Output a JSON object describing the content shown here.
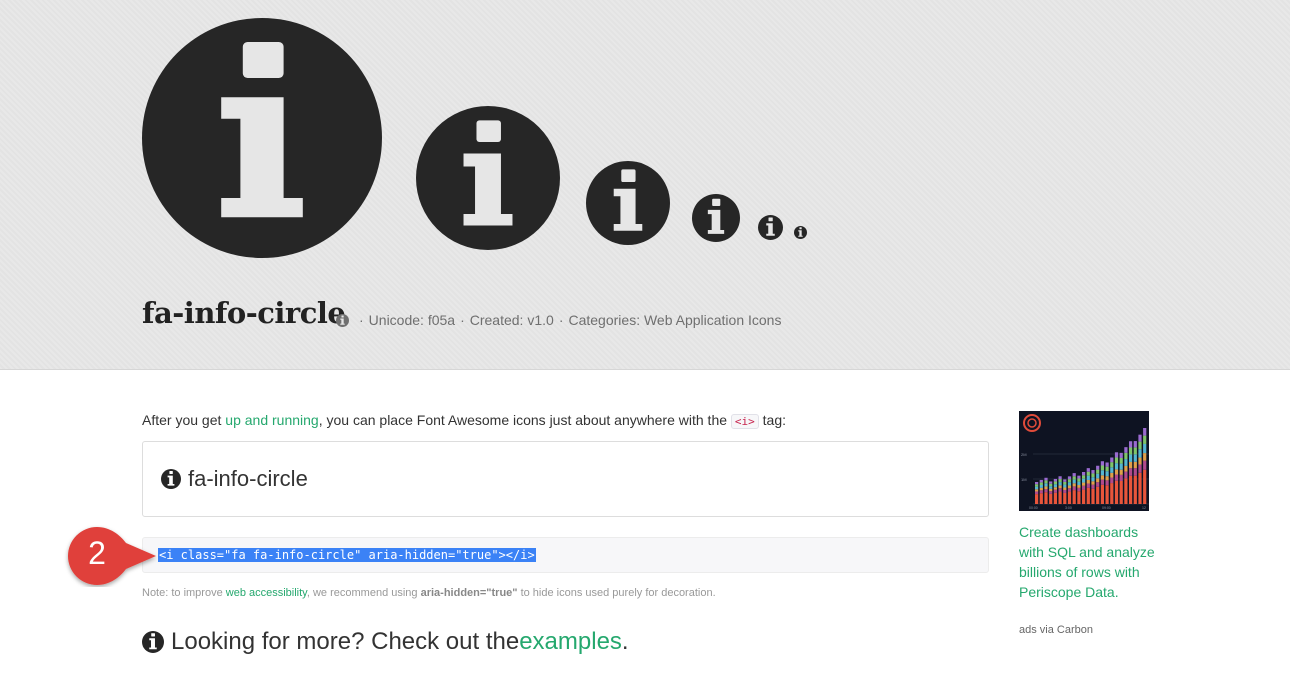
{
  "header": {
    "icon_name": "fa-info-circle",
    "meta": {
      "icon": "info-circle-icon",
      "unicode": "Unicode: f05a",
      "created": "Created: v1.0",
      "categories": "Categories: Web Application Icons",
      "separator": "·"
    },
    "size_variants": [
      "info-circle-icon",
      "info-circle-icon",
      "info-circle-icon",
      "info-circle-icon",
      "info-circle-icon",
      "info-circle-icon"
    ]
  },
  "main": {
    "intro": {
      "before": "After you get ",
      "link": "up and running",
      "after": ", you can place Font Awesome icons just about anywhere with the ",
      "tag": "<i>",
      "end": " tag:"
    },
    "demo": {
      "icon": "info-circle-icon",
      "label": "fa-info-circle"
    },
    "code": "<i class=\"fa fa-info-circle\" aria-hidden=\"true\"></i>",
    "callout": {
      "number": "2"
    },
    "note": {
      "before": "Note: to improve ",
      "link": "web accessibility",
      "middle": ", we recommend using ",
      "bold": "aria-hidden=\"true\"",
      "after": " to hide icons used purely for decoration."
    },
    "more": {
      "before": "Looking for more? Check out the ",
      "link": "examples",
      "after": "."
    }
  },
  "ad": {
    "text": "Create dashboards with SQL and analyze billions of rows with Periscope Data.",
    "via": "ads via Carbon"
  },
  "colors": {
    "accent": "#25a86e",
    "icon_dark": "#262626",
    "callout_red": "#e0413b",
    "selection": "#3b82f6"
  }
}
